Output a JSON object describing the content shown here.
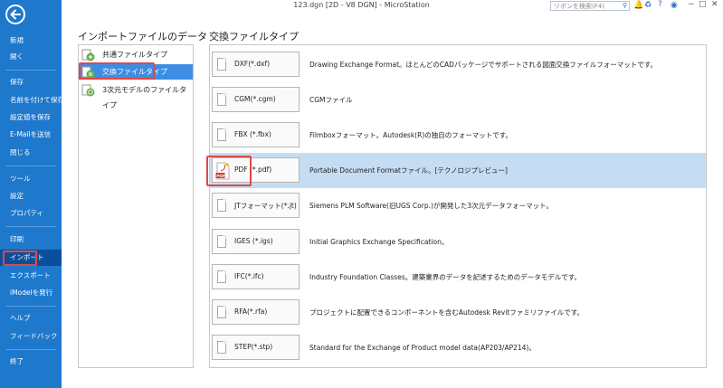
{
  "window": {
    "title": "123.dgn [2D - V8 DGN] - MicroStation",
    "search_placeholder": "リボンを検索(F4)",
    "controls": [
      "?",
      "−",
      "□",
      "✕"
    ]
  },
  "sidebar": {
    "items": [
      {
        "label": "新規",
        "active": false
      },
      {
        "label": "開く",
        "active": false
      },
      {
        "label": "保存",
        "active": false
      },
      {
        "label": "名前を付けて保存",
        "active": false
      },
      {
        "label": "設定値を保存",
        "active": false
      },
      {
        "label": "E-Mailを送信",
        "active": false
      },
      {
        "label": "閉じる",
        "active": false
      },
      {
        "label": "ツール",
        "active": false
      },
      {
        "label": "設定",
        "active": false
      },
      {
        "label": "プロパティ",
        "active": false
      },
      {
        "label": "印刷",
        "active": false
      },
      {
        "label": "インポート",
        "active": true
      },
      {
        "label": "エクスポート",
        "active": false
      },
      {
        "label": "iModelを発行",
        "active": false
      },
      {
        "label": "ヘルプ",
        "active": false
      },
      {
        "label": "フィードバック",
        "active": false
      },
      {
        "label": "終了",
        "active": false
      }
    ]
  },
  "import_panel": {
    "title": "インポートファイルのデータ",
    "categories": [
      {
        "label": "共通ファイルタイプ",
        "selected": false
      },
      {
        "label": "交換ファイルタイプ",
        "selected": true
      },
      {
        "label": "3次元モデルのファイルタイプ",
        "selected": false
      }
    ]
  },
  "exchange_panel": {
    "title": "交換ファイルタイプ",
    "types": [
      {
        "label": "DXF(*.dxf)",
        "desc": "Drawing Exchange Format。ほとんどのCADパッケージでサポートされる図面交換ファイルフォーマットです。",
        "selected": false,
        "icon": "document-icon"
      },
      {
        "label": "CGM(*.cgm)",
        "desc": "CGMファイル",
        "selected": false,
        "icon": "document-icon"
      },
      {
        "label": "FBX (*.fbx)",
        "desc": "Filmboxフォーマット。Autodesk(R)の独自のフォーマットです。",
        "selected": false,
        "icon": "document-icon"
      },
      {
        "label": "PDF (*.pdf)",
        "desc": "Portable Document Formatファイル。[テクノロジプレビュー]",
        "selected": true,
        "icon": "pdf-icon"
      },
      {
        "label": "JTフォーマット(*.jt)",
        "desc": "Siemens PLM Software(旧UGS Corp.)が開発した3次元データフォーマット。",
        "selected": false,
        "icon": "document-icon"
      },
      {
        "label": "IGES (*.igs)",
        "desc": "Initial Graphics Exchange Specification。",
        "selected": false,
        "icon": "document-icon"
      },
      {
        "label": "IFC(*.ifc)",
        "desc": "Industry Foundation Classes。建築業界のデータを記述するためのデータモデルです。",
        "selected": false,
        "icon": "document-icon"
      },
      {
        "label": "RFA(*.rfa)",
        "desc": "プロジェクトに配置できるコンポーネントを含むAutodesk Revitファミリファイルです。",
        "selected": false,
        "icon": "document-icon"
      },
      {
        "label": "STEP(*.stp)",
        "desc": "Standard for the Exchange of Product model data(AP203/AP214)。",
        "selected": false,
        "icon": "document-icon"
      }
    ]
  },
  "colors": {
    "sidebar": "#1e78cc",
    "sidebar_active": "#0b4f9a",
    "selected_category": "#3d8ee2",
    "selected_row": "#c6dcf3",
    "highlight_box": "#e04848"
  }
}
